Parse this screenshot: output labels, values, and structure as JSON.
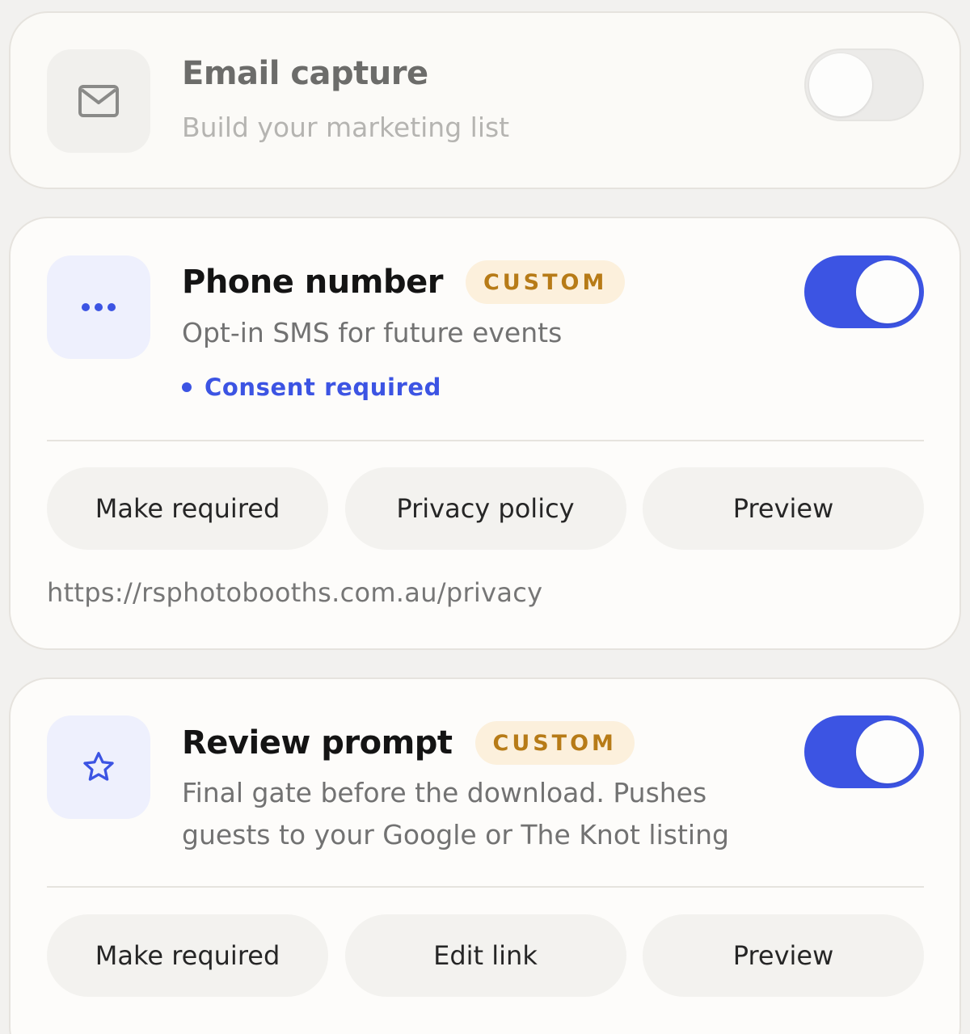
{
  "email_capture": {
    "title": "Email capture",
    "subtitle": "Build your marketing list",
    "icon": "envelope-icon",
    "enabled": false
  },
  "phone_number": {
    "title": "Phone number",
    "badge": "CUSTOM",
    "subtitle": "Opt-in SMS for future events",
    "consent": "Consent required",
    "icon": "more-dots-icon",
    "enabled": true,
    "buttons": [
      "Make required",
      "Privacy policy",
      "Preview"
    ],
    "url": "https://rsphotobooths.com.au/privacy"
  },
  "review_prompt": {
    "title": "Review prompt",
    "badge": "CUSTOM",
    "subtitle_line1": "Final gate before the download. Pushes",
    "subtitle_line2": "guests to your Google or The Knot listing",
    "icon": "star-icon",
    "enabled": true,
    "buttons": [
      "Make required",
      "Edit link",
      "Preview"
    ]
  },
  "colors": {
    "accent": "#3c54e3",
    "badge_bg": "#fcf0dc",
    "badge_text": "#b77b17",
    "page_bg": "#f2f1ef",
    "card_bg": "#fdfcfa"
  }
}
